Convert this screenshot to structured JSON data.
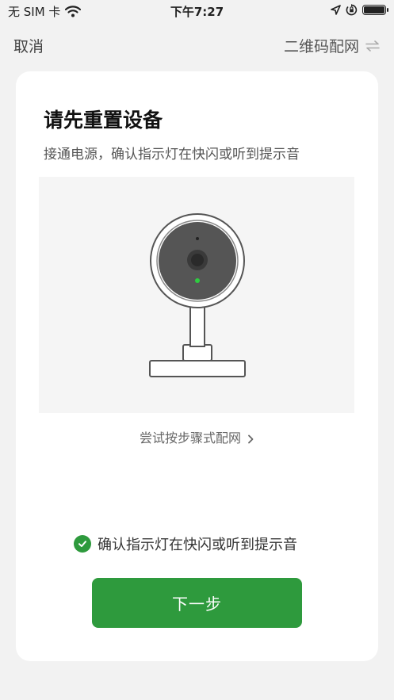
{
  "status_bar": {
    "carrier": "无 SIM 卡",
    "time": "下午7:27",
    "battery_level": 1.0,
    "icons": [
      "wifi-icon",
      "location-icon",
      "rotation-lock-icon",
      "battery-icon"
    ]
  },
  "nav": {
    "cancel_label": "取消",
    "qr_label": "二维码配网",
    "qr_icon": "switch-arrows-icon"
  },
  "main": {
    "title": "请先重置设备",
    "subtitle": "接通电源，确认指示灯在快闪或听到提示音",
    "illustration": "camera-icon",
    "try_link": "尝试按步骤式配网",
    "try_link_icon": "chevron-right-icon",
    "confirm_label": "确认指示灯在快闪或听到提示音",
    "confirm_checked": true,
    "next_label": "下一步"
  },
  "colors": {
    "accent": "#2e9a3d",
    "background": "#f2f2f2",
    "card": "#ffffff",
    "indicator_led": "#2ecc40"
  }
}
